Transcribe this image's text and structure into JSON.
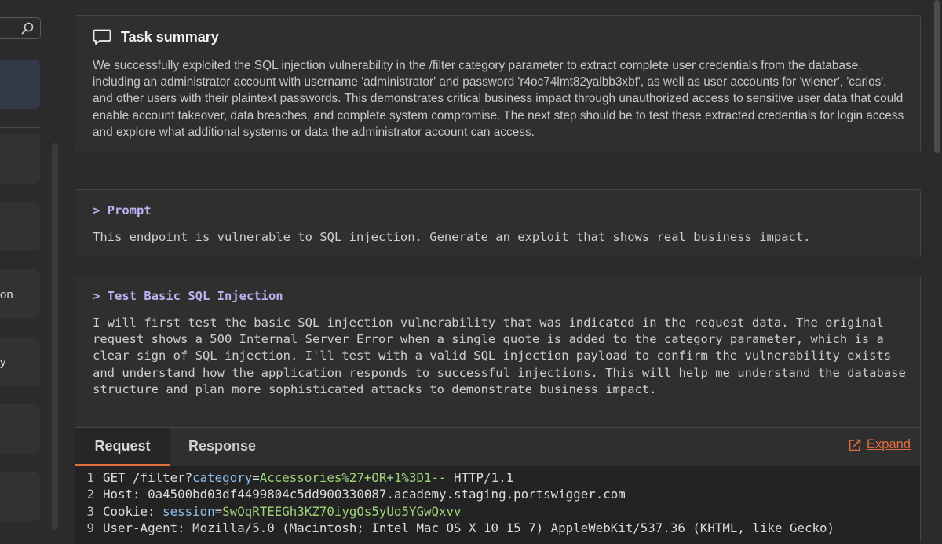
{
  "sidebar": {
    "items": [
      {
        "label": ""
      },
      {
        "label": ""
      },
      {
        "label": "on"
      },
      {
        "label": "y"
      },
      {
        "label": ""
      },
      {
        "label": ""
      }
    ]
  },
  "summary": {
    "title": "Task summary",
    "text": "We successfully exploited the SQL injection vulnerability in the /filter category parameter to extract complete user credentials from the database, including an administrator account with username 'administrator' and password 'r4oc74lmt82yalbb3xbf', as well as user accounts for 'wiener', 'carlos', and other users with their plaintext passwords. This demonstrates critical business impact through unauthorized access to sensitive user data that could enable account takeover, data breaches, and complete system compromise. The next step should be to test these extracted credentials for login access and explore what additional systems or data the administrator account can access."
  },
  "prompt": {
    "title": "> Prompt",
    "text": "This endpoint is vulnerable to SQL injection. Generate an exploit that shows real business impact."
  },
  "step": {
    "title": "> Test Basic SQL Injection",
    "text": "I will first test the basic SQL injection vulnerability that was indicated in the request data. The original request shows a 500 Internal Server Error when a single quote is added to the category parameter, which is a clear sign of SQL injection. I'll test with a valid SQL injection payload to confirm the vulnerability exists and understand how the application responds to successful injections. This will help me understand the database structure and plan more sophisticated attacks to demonstrate business impact.",
    "tabs": {
      "request": "Request",
      "response": "Response"
    },
    "expand_label": "Expand",
    "code": {
      "l1": {
        "n": "1",
        "a": "GET /filter?",
        "key": "category",
        "eq": "=",
        "val": "Accessories%27+OR+1%3D1--",
        "rest": " HTTP/1.1"
      },
      "l2": {
        "n": "2",
        "a": "Host: ",
        "rest": "0a4500bd03df4499804c5dd900330087.academy.staging.portswigger.com"
      },
      "l3": {
        "n": "3",
        "a": "Cookie: ",
        "key": "session",
        "eq": "=",
        "val": "SwOqRTEEGh3KZ70iygOs5yUo5YGwQxvv"
      },
      "l4": {
        "n": "9",
        "a": "User-Agent: ",
        "rest": "Mozilla/5.0 (Macintosh; Intel Mac OS X 10_15_7) AppleWebKit/537.36 (KHTML, like Gecko)"
      }
    }
  }
}
